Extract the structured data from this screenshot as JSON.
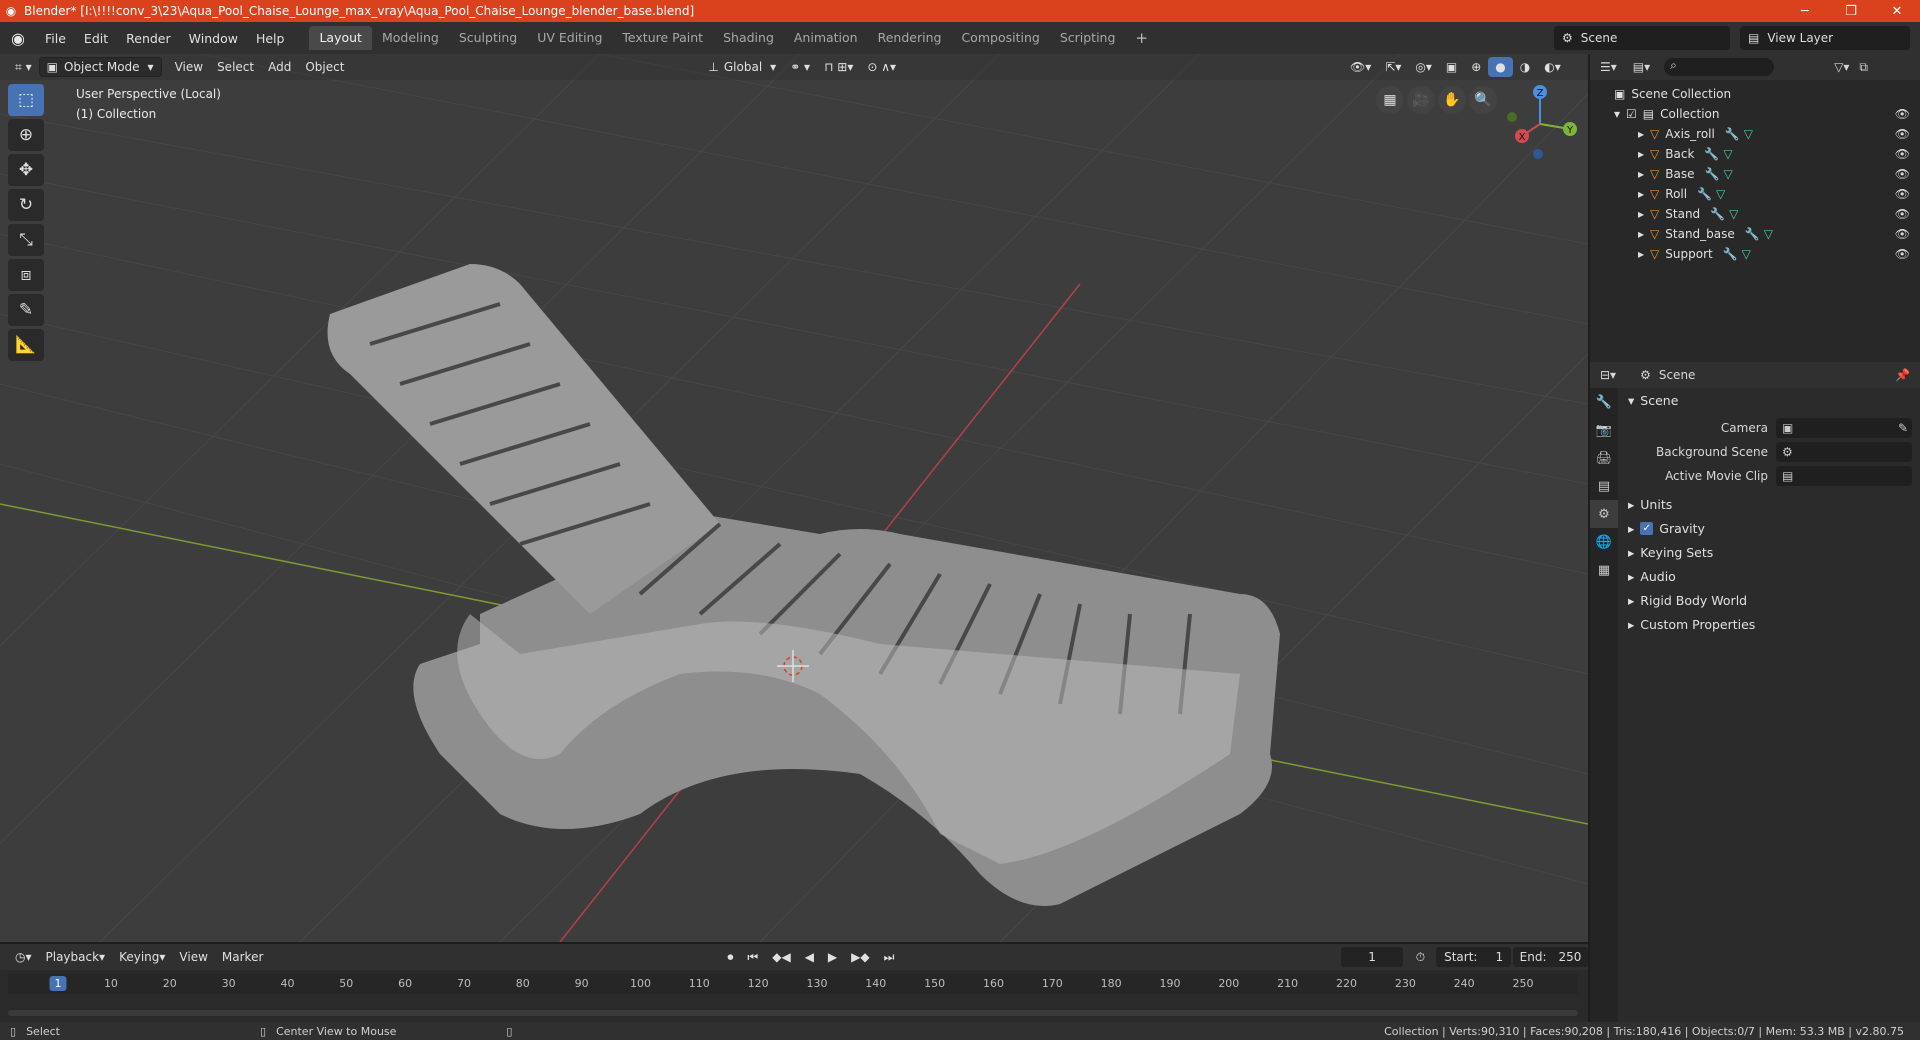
{
  "window": {
    "title": "Blender* [I:\\!!!!conv_3\\23\\Aqua_Pool_Chaise_Lounge_max_vray\\Aqua_Pool_Chaise_Lounge_blender_base.blend]"
  },
  "menu": {
    "file": "File",
    "edit": "Edit",
    "render": "Render",
    "window": "Window",
    "help": "Help"
  },
  "workspaces": [
    "Layout",
    "Modeling",
    "Sculpting",
    "UV Editing",
    "Texture Paint",
    "Shading",
    "Animation",
    "Rendering",
    "Compositing",
    "Scripting"
  ],
  "active_workspace": "Layout",
  "scene_selector": {
    "value": "Scene"
  },
  "view_layer_selector": {
    "value": "View Layer"
  },
  "viewport": {
    "mode": "Object Mode",
    "menus": {
      "view": "View",
      "select": "Select",
      "add": "Add",
      "object": "Object"
    },
    "transform": "Global",
    "overlay_line1": "User Perspective (Local)",
    "overlay_line2": "(1) Collection",
    "gizmo": {
      "z": "Z",
      "y": "Y",
      "x": "X"
    }
  },
  "outliner": {
    "root": "Scene Collection",
    "collection": "Collection",
    "objects": [
      "Axis_roll",
      "Back",
      "Base",
      "Roll",
      "Stand",
      "Stand_base",
      "Support"
    ]
  },
  "properties": {
    "header": "Scene",
    "section": "Scene",
    "camera_label": "Camera",
    "background_scene_label": "Background Scene",
    "active_movie_clip_label": "Active Movie Clip",
    "subsections": [
      "Units",
      "Gravity",
      "Keying Sets",
      "Audio",
      "Rigid Body World",
      "Custom Properties"
    ],
    "gravity_checked": true
  },
  "timeline": {
    "menus": {
      "playback": "Playback",
      "keying": "Keying",
      "view": "View",
      "marker": "Marker"
    },
    "current_frame": "1",
    "start_label": "Start:",
    "start": "1",
    "end_label": "End:",
    "end": "250",
    "ticks": [
      "1",
      "10",
      "20",
      "30",
      "40",
      "50",
      "60",
      "70",
      "80",
      "90",
      "100",
      "110",
      "120",
      "130",
      "140",
      "150",
      "160",
      "170",
      "180",
      "190",
      "200",
      "210",
      "220",
      "230",
      "240",
      "250"
    ]
  },
  "statusbar": {
    "select": "Select",
    "center": "Center View to Mouse",
    "stats": "Collection | Verts:90,310 | Faces:90,208 | Tris:180,416 | Objects:0/7 | Mem: 53.3 MB | v2.80.75"
  },
  "colors": {
    "title_bar": "#d9421c",
    "accent": "#4772b3",
    "viewport_bg": "#3d3d3d",
    "x_axis": "#d24a52",
    "y_axis": "#7fb534",
    "z_axis": "#4a8fe0"
  }
}
